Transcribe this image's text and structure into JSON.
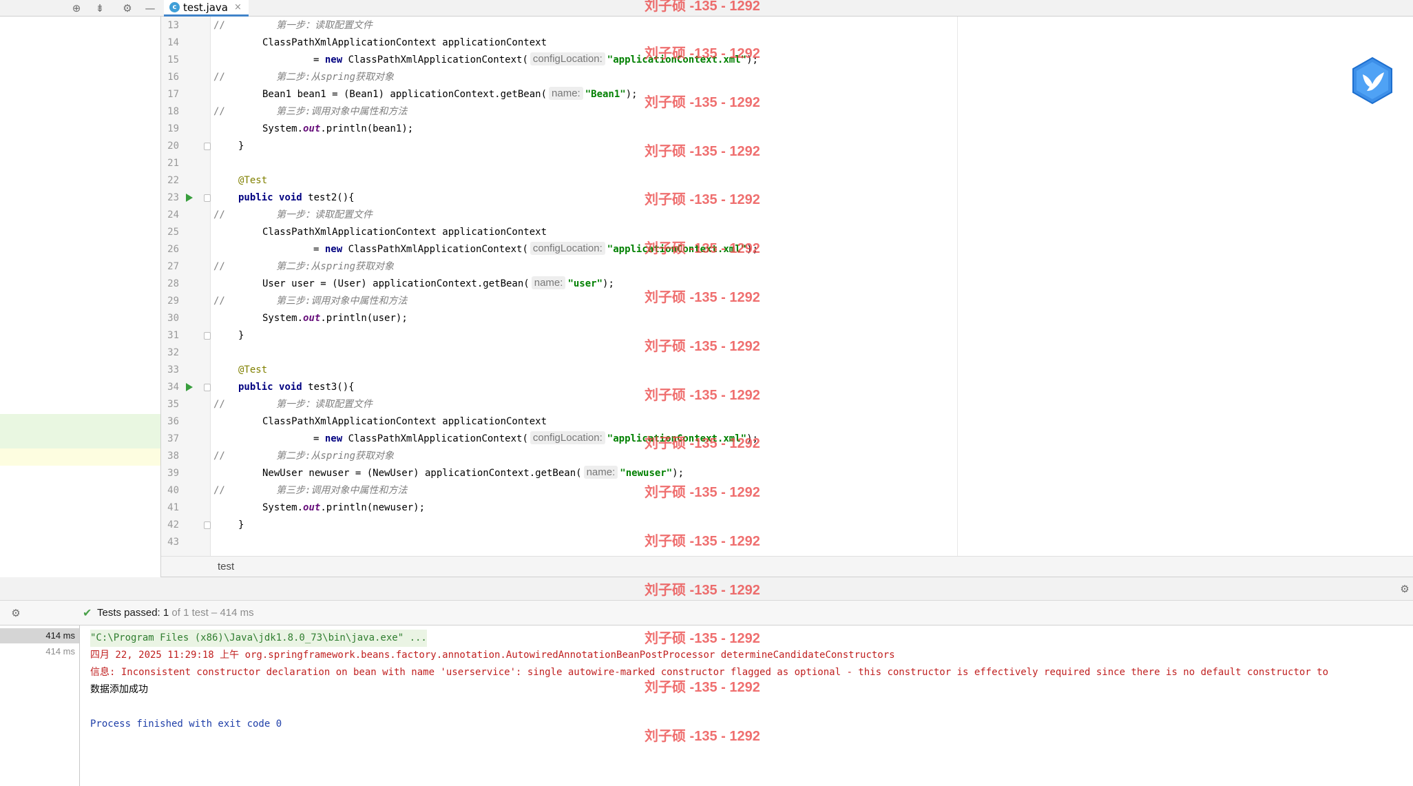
{
  "editor": {
    "tab": {
      "icon_letter": "c",
      "label": "test.java",
      "close_glyph": "×"
    },
    "breadcrumb": "test",
    "lines": [
      {
        "num": "13",
        "comment": "//",
        "code": [
          {
            "t": "第一步：读取配置文件",
            "c": "cmt"
          }
        ],
        "indent": 2
      },
      {
        "num": "14",
        "code": [
          {
            "t": "ClassPathXmlApplicationContext applicationContext"
          }
        ],
        "indent": 1
      },
      {
        "num": "15",
        "code": [
          {
            "t": "= ",
            "c": ""
          },
          {
            "t": "new",
            "c": "kw"
          },
          {
            "t": " ClassPathXmlApplicationContext("
          },
          {
            "hint": "configLocation:"
          },
          {
            "t": "\"applicationContext.xml\"",
            "c": "str"
          },
          {
            "t": ");"
          }
        ],
        "indent": 3
      },
      {
        "num": "16",
        "comment": "//",
        "code": [
          {
            "t": "第二步:从spring获取对象",
            "c": "cmt"
          }
        ],
        "indent": 2
      },
      {
        "num": "17",
        "code": [
          {
            "t": "Bean1 bean1 = (Bean1) applicationContext.getBean("
          },
          {
            "hint": "name:"
          },
          {
            "t": "\"Bean1\"",
            "c": "str"
          },
          {
            "t": ");"
          }
        ],
        "indent": 1
      },
      {
        "num": "18",
        "comment": "//",
        "code": [
          {
            "t": "第三步:调用对象中属性和方法",
            "c": "cmt"
          }
        ],
        "indent": 2
      },
      {
        "num": "19",
        "code": [
          {
            "t": "System."
          },
          {
            "t": "out",
            "c": "fld"
          },
          {
            "t": ".println(bean1);"
          }
        ],
        "indent": 1
      },
      {
        "num": "20",
        "fold": true,
        "code": [
          {
            "t": "}"
          }
        ],
        "indent": 0
      },
      {
        "num": "21",
        "code": [],
        "indent": 0
      },
      {
        "num": "22",
        "code": [
          {
            "t": "@Test",
            "c": "ann"
          }
        ],
        "indent": 0
      },
      {
        "num": "23",
        "run": true,
        "fold": true,
        "code": [
          {
            "t": "public",
            "c": "kw"
          },
          {
            "t": " "
          },
          {
            "t": "void",
            "c": "kw"
          },
          {
            "t": " test2(){"
          }
        ],
        "indent": 0
      },
      {
        "num": "24",
        "comment": "//",
        "code": [
          {
            "t": "第一步：读取配置文件",
            "c": "cmt"
          }
        ],
        "indent": 2
      },
      {
        "num": "25",
        "code": [
          {
            "t": "ClassPathXmlApplicationContext applicationContext"
          }
        ],
        "indent": 1
      },
      {
        "num": "26",
        "code": [
          {
            "t": "= ",
            "c": ""
          },
          {
            "t": "new",
            "c": "kw"
          },
          {
            "t": " ClassPathXmlApplicationContext("
          },
          {
            "hint": "configLocation:"
          },
          {
            "t": "\"applicationContext.xml\"",
            "c": "str"
          },
          {
            "t": ");"
          }
        ],
        "indent": 3
      },
      {
        "num": "27",
        "comment": "//",
        "code": [
          {
            "t": "第二步:从spring获取对象",
            "c": "cmt"
          }
        ],
        "indent": 2
      },
      {
        "num": "28",
        "code": [
          {
            "t": "User user = (User) applicationContext.getBean("
          },
          {
            "hint": "name:"
          },
          {
            "t": "\"user\"",
            "c": "str"
          },
          {
            "t": ");"
          }
        ],
        "indent": 1
      },
      {
        "num": "29",
        "comment": "//",
        "code": [
          {
            "t": "第三步:调用对象中属性和方法",
            "c": "cmt"
          }
        ],
        "indent": 2
      },
      {
        "num": "30",
        "code": [
          {
            "t": "System."
          },
          {
            "t": "out",
            "c": "fld"
          },
          {
            "t": ".println(user);"
          }
        ],
        "indent": 1
      },
      {
        "num": "31",
        "fold": true,
        "code": [
          {
            "t": "}"
          }
        ],
        "indent": 0
      },
      {
        "num": "32",
        "code": [],
        "indent": 0
      },
      {
        "num": "33",
        "code": [
          {
            "t": "@Test",
            "c": "ann"
          }
        ],
        "indent": 0
      },
      {
        "num": "34",
        "run": true,
        "fold": true,
        "code": [
          {
            "t": "public",
            "c": "kw"
          },
          {
            "t": " "
          },
          {
            "t": "void",
            "c": "kw"
          },
          {
            "t": " test3(){"
          }
        ],
        "indent": 0
      },
      {
        "num": "35",
        "comment": "//",
        "code": [
          {
            "t": "第一步：读取配置文件",
            "c": "cmt"
          }
        ],
        "indent": 2
      },
      {
        "num": "36",
        "code": [
          {
            "t": "ClassPathXmlApplicationContext applicationContext"
          }
        ],
        "indent": 1
      },
      {
        "num": "37",
        "code": [
          {
            "t": "= ",
            "c": ""
          },
          {
            "t": "new",
            "c": "kw"
          },
          {
            "t": " ClassPathXmlApplicationContext("
          },
          {
            "hint": "configLocation:"
          },
          {
            "t": "\"applicationContext.xml\"",
            "c": "str"
          },
          {
            "t": ");"
          }
        ],
        "indent": 3
      },
      {
        "num": "38",
        "comment": "//",
        "code": [
          {
            "t": "第二步:从spring获取对象",
            "c": "cmt"
          }
        ],
        "indent": 2
      },
      {
        "num": "39",
        "code": [
          {
            "t": "NewUser newuser = (NewUser) applicationContext.getBean("
          },
          {
            "hint": "name:"
          },
          {
            "t": "\"newuser\"",
            "c": "str"
          },
          {
            "t": ");"
          }
        ],
        "indent": 1
      },
      {
        "num": "40",
        "comment": "//",
        "code": [
          {
            "t": "第三步:调用对象中属性和方法",
            "c": "cmt"
          }
        ],
        "indent": 2
      },
      {
        "num": "41",
        "code": [
          {
            "t": "System."
          },
          {
            "t": "out",
            "c": "fld"
          },
          {
            "t": ".println(newuser);"
          }
        ],
        "indent": 1
      },
      {
        "num": "42",
        "fold": true,
        "code": [
          {
            "t": "}"
          }
        ],
        "indent": 0
      },
      {
        "num": "43",
        "code": [],
        "indent": 0
      }
    ]
  },
  "run_panel": {
    "status_main": "Tests passed: 1",
    "status_sub": " of 1 test – 414 ms",
    "tree": [
      "414 ms",
      "414 ms"
    ],
    "console": [
      {
        "text": "\"C:\\Program Files (x86)\\Java\\jdk1.8.0_73\\bin\\java.exe\" ...",
        "c": "c-cmd"
      },
      {
        "text": "四月 22, 2025 11:29:18 上午 org.springframework.beans.factory.annotation.AutowiredAnnotationBeanPostProcessor determineCandidateConstructors",
        "c": "c-red"
      },
      {
        "text": "信息: Inconsistent constructor declaration on bean with name 'userservice': single autowire-marked constructor flagged as optional - this constructor is effectively required since there is no default constructor to",
        "c": "c-red"
      },
      {
        "text": "数据添加成功",
        "c": "c-out"
      },
      {
        "text": "",
        "c": "c-out"
      },
      {
        "text": "Process finished with exit code 0",
        "c": "c-blue"
      }
    ]
  },
  "watermark": {
    "text": "刘子硕 -135 - 1292",
    "count": 16
  },
  "toolbar_icons": [
    "crosshair-icon",
    "collapse-icon",
    "gear-icon",
    "minimize-icon"
  ],
  "colors": {
    "accent_tab": "#4083c9",
    "pass_green": "#4aa14a",
    "string_green": "#008000",
    "keyword_navy": "#000080",
    "watermark_red": "#eb4646"
  }
}
